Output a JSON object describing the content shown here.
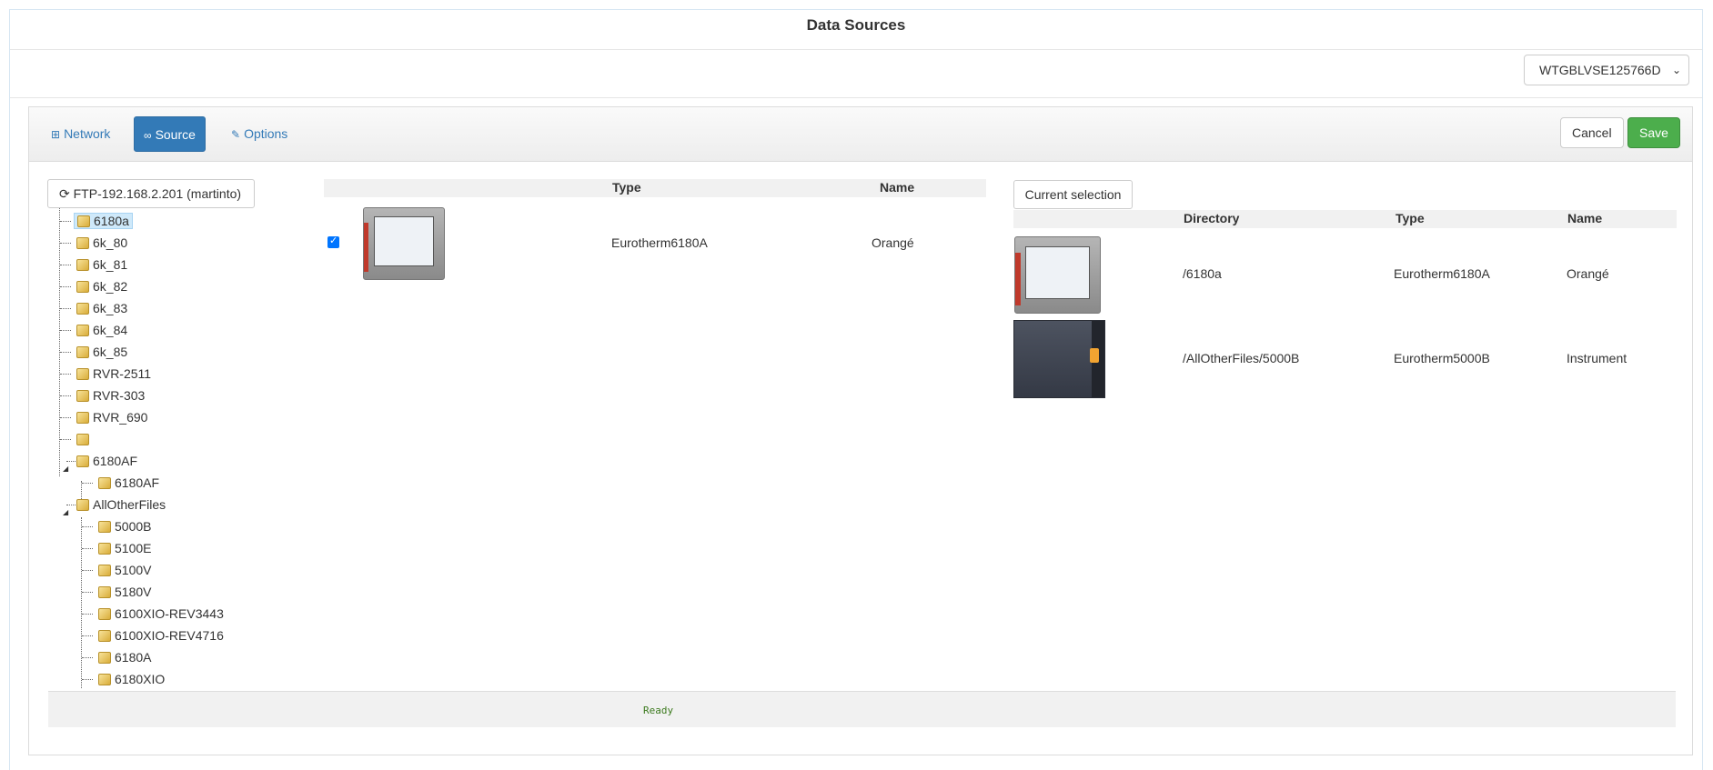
{
  "window": {
    "title": "Data Sources"
  },
  "server_select": {
    "value": "WTGBLVSE125766D"
  },
  "tabs": [
    {
      "label": "Network",
      "icon": "sitemap-icon"
    },
    {
      "label": "Source",
      "icon": "binoculars-icon",
      "active": true
    },
    {
      "label": "Options",
      "icon": "wrench-icon"
    }
  ],
  "buttons": {
    "cancel": "Cancel",
    "save": "Save"
  },
  "tree": {
    "root_label": "FTP-192.168.2.201 (martinto)",
    "nodes": [
      {
        "label": "6180a",
        "selected": true
      },
      {
        "label": "6k_80"
      },
      {
        "label": "6k_81"
      },
      {
        "label": "6k_82"
      },
      {
        "label": "6k_83"
      },
      {
        "label": "6k_84"
      },
      {
        "label": "6k_85"
      },
      {
        "label": "RVR-2511"
      },
      {
        "label": "RVR-303"
      },
      {
        "label": "RVR_690"
      },
      {
        "label": ""
      },
      {
        "label": "6180AF",
        "expanded": true,
        "children": [
          {
            "label": "6180AF"
          }
        ]
      },
      {
        "label": "AllOtherFiles",
        "expanded": true,
        "children": [
          {
            "label": "5000B"
          },
          {
            "label": "5100E"
          },
          {
            "label": "5100V"
          },
          {
            "label": "5180V"
          },
          {
            "label": "6100XIO-REV3443"
          },
          {
            "label": "6100XIO-REV4716"
          },
          {
            "label": "6180A"
          },
          {
            "label": "6180XIO"
          }
        ]
      }
    ]
  },
  "available": {
    "columns": {
      "type": "Type",
      "name": "Name"
    },
    "rows": [
      {
        "checked": true,
        "type": "Eurotherm6180A",
        "name": "Orangé"
      }
    ]
  },
  "current_selection": {
    "button": "Current selection",
    "columns": {
      "directory": "Directory",
      "type": "Type",
      "name": "Name"
    },
    "rows": [
      {
        "directory": "/6180a",
        "type": "Eurotherm6180A",
        "name": "Orangé"
      },
      {
        "directory": "/AllOtherFiles/5000B",
        "type": "Eurotherm5000B",
        "name": "Instrument"
      }
    ]
  },
  "status": {
    "text": "Ready"
  },
  "colors": {
    "primary": "#337ab7",
    "success": "#4cae4c",
    "status_text": "#3c7a1e"
  }
}
